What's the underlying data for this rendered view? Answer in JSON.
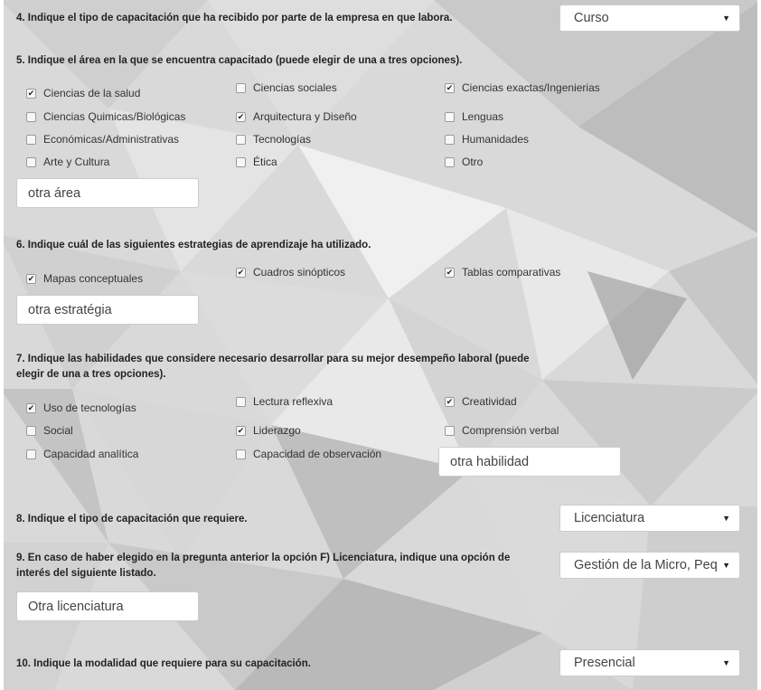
{
  "questions": {
    "q4": {
      "text": "4. Indique el tipo de capacitación que ha recibido por parte de la empresa en que labora.",
      "selected": "Curso"
    },
    "q5": {
      "text": "5. Indique el área en la que se encuentra capacitado (puede elegir de una a tres opciones).",
      "options": [
        {
          "label": "Ciencias de la salud",
          "checked": true
        },
        {
          "label": "Ciencias sociales",
          "checked": false
        },
        {
          "label": "Ciencias exactas/Ingenierias",
          "checked": true
        },
        {
          "label": "Ciencias Quimicas/Biológicas",
          "checked": false
        },
        {
          "label": "Arquitectura y Diseño",
          "checked": true
        },
        {
          "label": "Lenguas",
          "checked": false
        },
        {
          "label": "Económicas/Administrativas",
          "checked": false
        },
        {
          "label": "Tecnologías",
          "checked": false
        },
        {
          "label": "Humanidades",
          "checked": false
        },
        {
          "label": "Arte y Cultura",
          "checked": false
        },
        {
          "label": "Ética",
          "checked": false
        },
        {
          "label": "Otro",
          "checked": false
        }
      ],
      "other_value": "otra área"
    },
    "q6": {
      "text": "6. Indique cuál de las siguientes estrategias de aprendizaje ha utilizado.",
      "options": [
        {
          "label": "Mapas conceptuales",
          "checked": true
        },
        {
          "label": "Cuadros sinópticos",
          "checked": true
        },
        {
          "label": "Tablas comparativas",
          "checked": true
        }
      ],
      "other_value": "otra estratégia"
    },
    "q7": {
      "text_line1": "7. Indique las habilidades que considere necesario desarrollar para su mejor desempeño laboral (puede",
      "text_line2": "elegir de una a tres opciones).",
      "options": [
        {
          "label": "Uso de tecnologías",
          "checked": true
        },
        {
          "label": "Lectura reflexiva",
          "checked": false
        },
        {
          "label": "Creatividad",
          "checked": true
        },
        {
          "label": "Social",
          "checked": false
        },
        {
          "label": "Liderazgo",
          "checked": true
        },
        {
          "label": "Comprensión verbal",
          "checked": false
        },
        {
          "label": "Capacidad analítica",
          "checked": false
        },
        {
          "label": "Capacidad de observación",
          "checked": false
        }
      ],
      "other_value": "otra habilidad"
    },
    "q8": {
      "text": "8. Indique el tipo de capacitación que requiere.",
      "selected": "Licenciatura"
    },
    "q9": {
      "text_line1": "9. En caso de haber elegido en la pregunta anterior la opción F) Licenciatura, indique una opción de",
      "text_line2": "interés del siguiente listado.",
      "selected": "Gestión de la Micro, Pequeña y Mediana Empresa",
      "other_value": "Otra licenciatura"
    },
    "q10": {
      "text": "10. Indique la modalidad que requiere para su capacitación.",
      "selected": "Presencial"
    }
  },
  "icons": {
    "dropdown": "triangle-down-icon",
    "checkbox_mark": "check-icon"
  },
  "colors": {
    "background": "#d6d6d6",
    "field_bg": "#ffffff",
    "field_border": "#cccccc"
  }
}
